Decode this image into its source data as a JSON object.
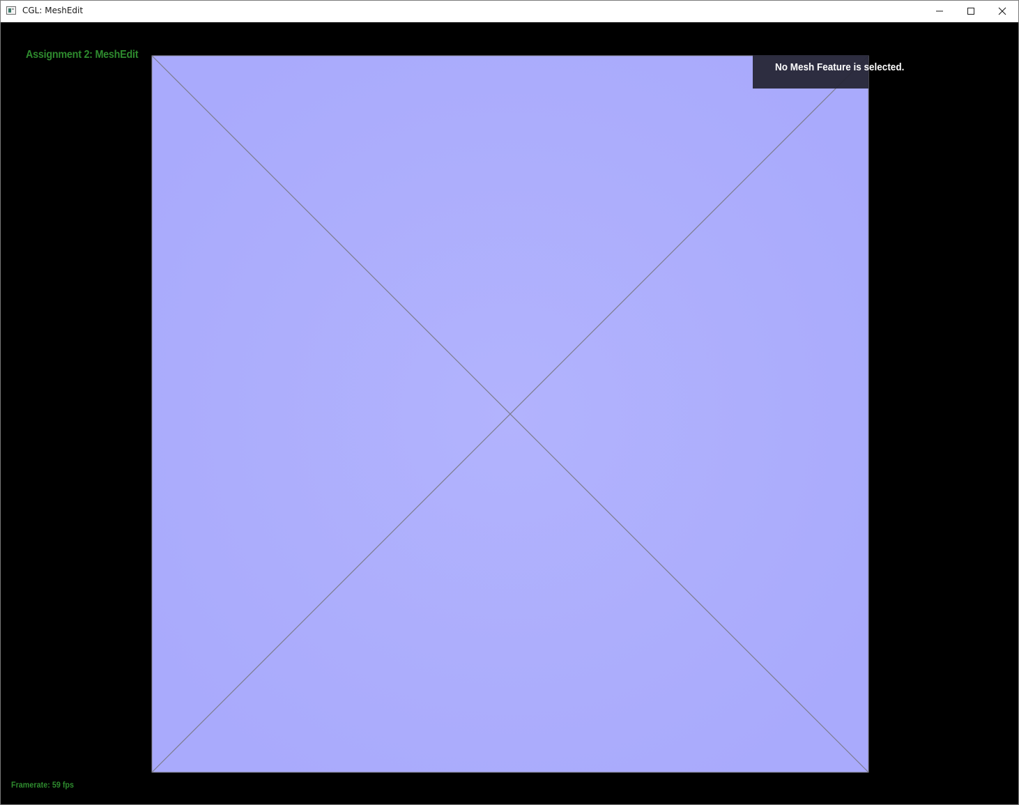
{
  "window": {
    "title": "CGL: MeshEdit",
    "icon": "app-window-icon",
    "controls": {
      "minimize_icon": "minimize-icon",
      "maximize_icon": "maximize-icon",
      "close_icon": "close-icon"
    }
  },
  "hud": {
    "title": "Assignment 2: MeshEdit",
    "selection_info": "No Mesh Feature is selected.",
    "framerate": "Framerate: 59 fps"
  },
  "colors": {
    "background": "#000000",
    "mesh_fill": "#adaefc",
    "mesh_edge": "#7c7c8c",
    "hud_text": "#2e8b2e",
    "panel_bg": "#262636",
    "panel_text": "#ffffff"
  }
}
